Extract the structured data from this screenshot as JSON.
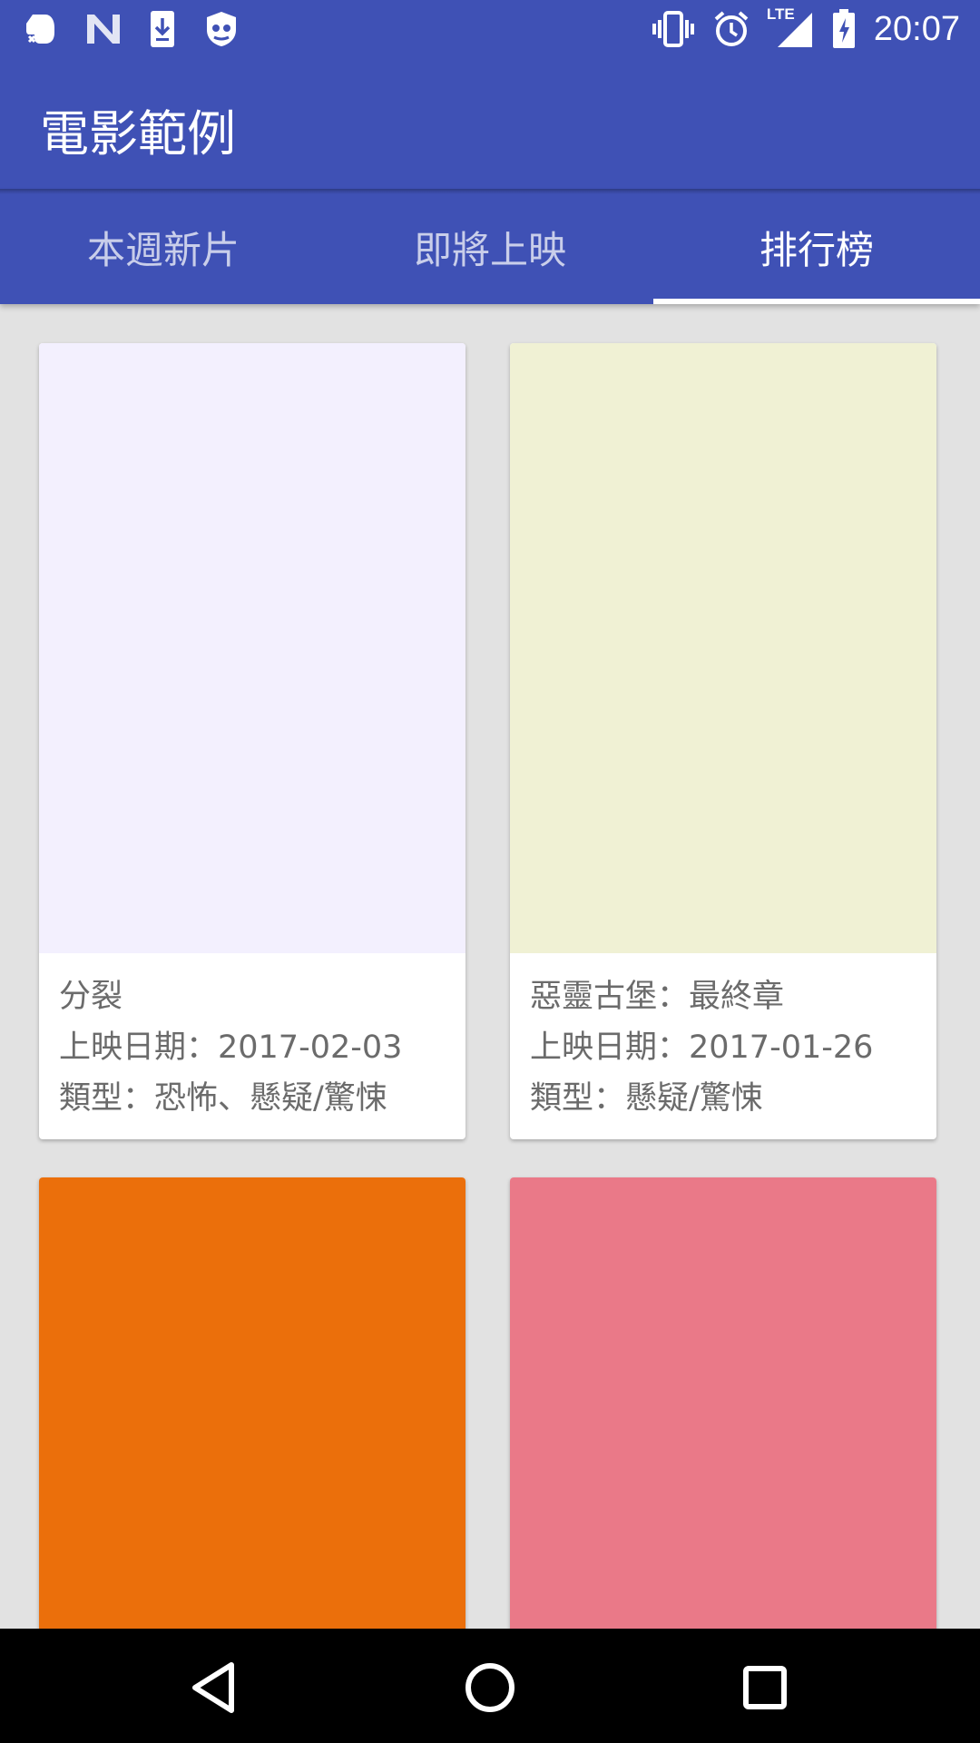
{
  "status_bar": {
    "time": "20:07",
    "left_icons": [
      "evernote-icon",
      "n-icon",
      "download-icon",
      "shield-icon"
    ],
    "right_icons": [
      "vibrate-icon",
      "alarm-icon",
      "lte-signal-icon",
      "battery-charging-icon"
    ],
    "lte_label": "LTE"
  },
  "app_bar": {
    "title": "電影範例",
    "color": "#3f51b5"
  },
  "tabs": [
    {
      "label": "本週新片",
      "active": false
    },
    {
      "label": "即將上映",
      "active": false
    },
    {
      "label": "排行榜",
      "active": true
    }
  ],
  "movies": [
    {
      "title": "分裂",
      "release": "上映日期：2017-02-03",
      "genre": "類型：恐怖、懸疑/驚悚",
      "poster_color": "#f3f0fe"
    },
    {
      "title": "惡靈古堡：最終章",
      "release": "上映日期：2017-01-26",
      "genre": "類型：懸疑/驚悚",
      "poster_color": "#f0f1d4"
    },
    {
      "poster_color": "#eb6f0b"
    },
    {
      "poster_color": "#ea7988"
    }
  ],
  "nav_bar": {
    "buttons": [
      "back-icon",
      "home-icon",
      "recents-icon"
    ]
  }
}
